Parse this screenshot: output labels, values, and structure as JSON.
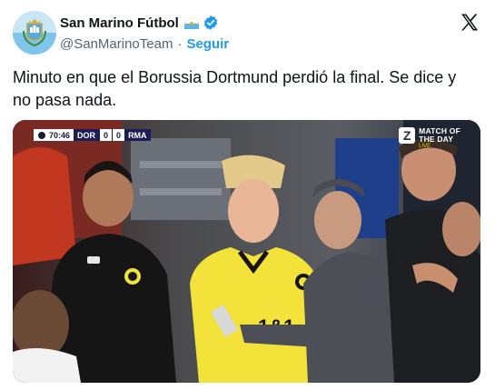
{
  "account": {
    "display_name": "San Marino Fútbol",
    "handle": "@SanMarinoTeam",
    "separator": "·",
    "follow_label": "Seguir",
    "verified_color": "#1d9bf0"
  },
  "tweet": {
    "text": "Minuto en que el Borussia Dortmund perdió la final. Se dice y no pasa nada."
  },
  "media": {
    "scorebug": {
      "clock": "70:46",
      "home_team": "DOR",
      "home_score": "0",
      "away_score": "0",
      "away_team": "RMA"
    },
    "broadcast": {
      "line1": "MATCH OF",
      "line2": "THE DAY",
      "live": "LIVE"
    },
    "shirt_text": "1&1"
  },
  "colors": {
    "accent": "#1d9bf0",
    "text": "#0f1419",
    "muted": "#536471",
    "bvb_yellow": "#f3e23a"
  }
}
